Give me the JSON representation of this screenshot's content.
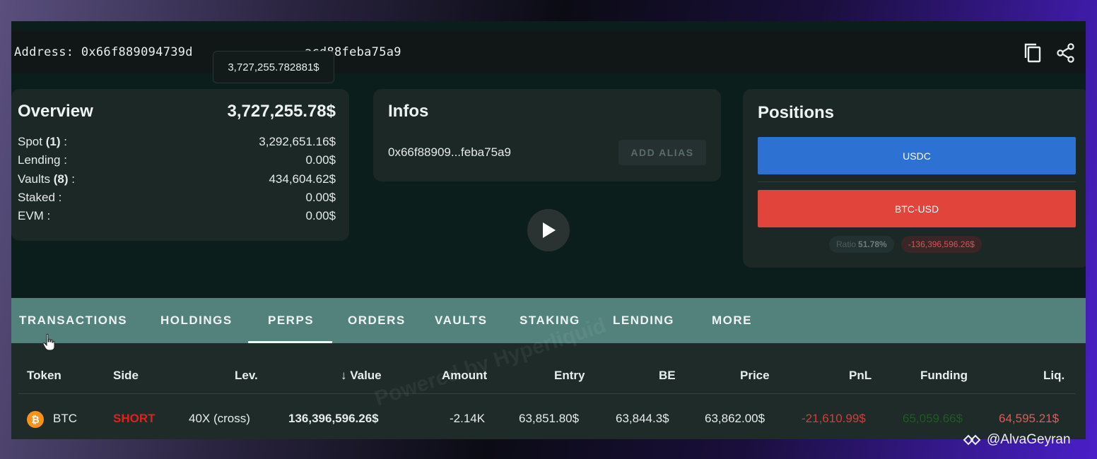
{
  "address_bar": {
    "text": "Address: 0x66f889094739d               acd88feba75a9"
  },
  "tooltip": {
    "text": "3,727,255.782881$"
  },
  "overview": {
    "title": "Overview",
    "total": "3,727,255.78$",
    "rows": [
      {
        "label": "Spot ",
        "count": "(1)",
        "suffix": " :",
        "value": "3,292,651.16$"
      },
      {
        "label": "Lending :",
        "count": "",
        "suffix": "",
        "value": "0.00$"
      },
      {
        "label": "Vaults ",
        "count": "(8)",
        "suffix": " :",
        "value": "434,604.62$"
      },
      {
        "label": "Staked :",
        "count": "",
        "suffix": "",
        "value": "0.00$"
      },
      {
        "label": "EVM :",
        "count": "",
        "suffix": "",
        "value": "0.00$"
      }
    ]
  },
  "infos": {
    "title": "Infos",
    "address": "0x66f88909...feba75a9",
    "alias_button": "ADD ALIAS"
  },
  "positions": {
    "title": "Positions",
    "usdc_label": "USDC",
    "btc_label": "BTC-USD",
    "ratio_label": "Ratio",
    "ratio_value": "51.78%",
    "negative_value": "-136,396,596.26$",
    "usdc_color": "#2d72d2",
    "btc_color": "#e0443a"
  },
  "tabs": {
    "items": [
      "TRANSACTIONS",
      "HOLDINGS",
      "PERPS",
      "ORDERS",
      "VAULTS",
      "STAKING",
      "LENDING",
      "MORE"
    ],
    "active": "PERPS"
  },
  "table": {
    "headers": [
      "Token",
      "Side",
      "Lev.",
      "↓ Value",
      "Amount",
      "Entry",
      "BE",
      "Price",
      "PnL",
      "Funding",
      "Liq."
    ],
    "row": {
      "token": "BTC",
      "side": "SHORT",
      "lev": "40X (cross)",
      "value": "136,396,596.26$",
      "amount": "-2.14K",
      "entry": "63,851.80$",
      "be": "63,844.3$",
      "price": "63,862.00$",
      "pnl": "-21,610.99$",
      "funding": "65,059.66$",
      "liq": "64,595.21$"
    }
  },
  "watermark": "Powered by Hyperliquid",
  "credit": "@AlvaGeyran",
  "colors": {
    "short": "#e02020",
    "pnl_negative": "#d83a3a",
    "funding_positive": "#1e5a22",
    "liq": "#e05a5a",
    "tabs_bg": "#53827c"
  }
}
